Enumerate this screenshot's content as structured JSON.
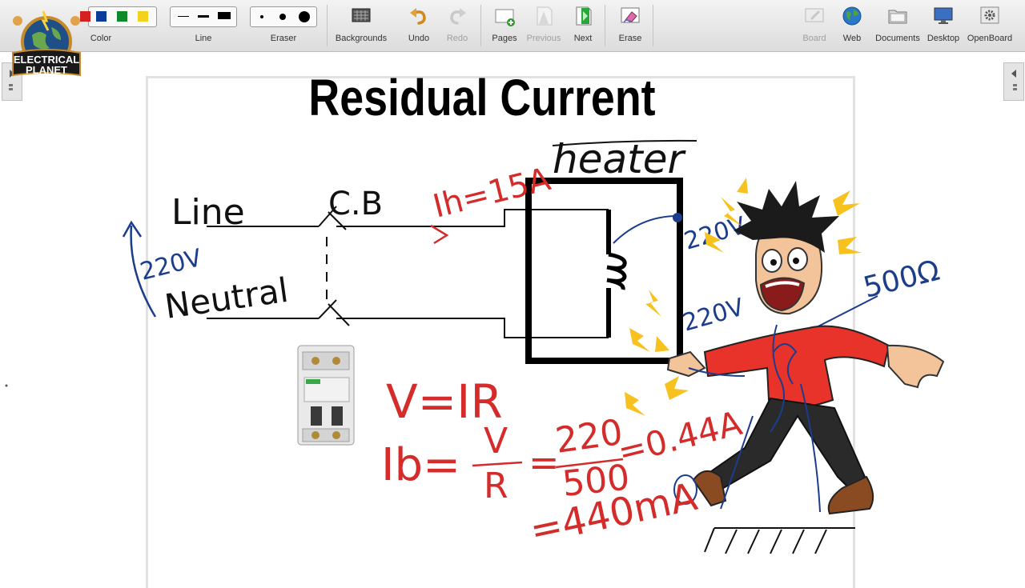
{
  "toolbar": {
    "color_label": "Color",
    "line_label": "Line",
    "eraser_label": "Eraser",
    "backgrounds_label": "Backgrounds",
    "undo_label": "Undo",
    "redo_label": "Redo",
    "pages_label": "Pages",
    "previous_label": "Previous",
    "next_label": "Next",
    "erase_label": "Erase",
    "board_label": "Board",
    "web_label": "Web",
    "documents_label": "Documents",
    "desktop_label": "Desktop",
    "openboard_label": "OpenBoard",
    "swatch_colors": [
      "#d42020",
      "#0a3c9a",
      "#0d8a2a",
      "#f2d21a"
    ]
  },
  "logo": {
    "line1": "ELECTRICAL",
    "line2": "PLANET"
  },
  "board": {
    "title": "Residual Current",
    "labels": {
      "heater": "heater",
      "line": "Line",
      "cb": "C.B",
      "neutral": "Neutral",
      "supply_voltage": "220V",
      "ih": "Ih=15A",
      "v_top": "220V",
      "v_bottom": "220V",
      "resistance": "500Ω"
    },
    "equations": {
      "ohm": "V=IR",
      "ib_lhs": "Ib=",
      "frac1_num": "V",
      "frac1_den": "R",
      "eq": "=",
      "frac2_num": "220",
      "frac2_den": "500",
      "result": "=0.44A",
      "result_ma": "=440mA"
    }
  }
}
